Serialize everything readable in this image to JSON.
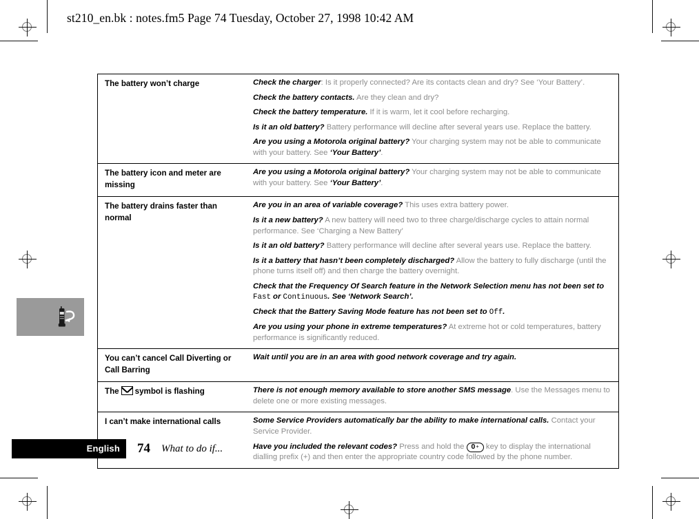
{
  "page_header": "st210_en.bk : notes.fm5  Page 74  Tuesday, October 27, 1998  10:42 AM",
  "thumb_tab": {
    "icon": "phone-with-question-icon",
    "color": "#9a9a9a"
  },
  "footer": {
    "language": "English",
    "page_number": "74",
    "section_title": "What to do if...",
    "bar_color": "#000000"
  },
  "table": {
    "rows": [
      {
        "symptom": "The battery won’t charge",
        "answers": [
          {
            "q": "Check the charger",
            "rest": ": Is it properly connected? Are its contacts clean and dry? See ‘Your Battery’."
          },
          {
            "q": "Check the battery contacts.",
            "rest": " Are they clean and dry?"
          },
          {
            "q": "Check the battery temperature.",
            "rest": " If it is warm, let it cool before recharging."
          },
          {
            "q": "Is it an old battery?",
            "rest": " Battery performance will decline after several years use. Replace the battery."
          },
          {
            "q": "Are you using a Motorola original battery?",
            "rest": " Your charging system may not be able to communicate with your battery. See ",
            "ref": "‘Your Battery’",
            "tail": "."
          }
        ]
      },
      {
        "symptom": "The battery icon and meter are missing",
        "answers": [
          {
            "q": "Are you using a Motorola original battery?",
            "rest": " Your charging system may not be able to communicate with your battery. See ",
            "ref": "‘Your Battery’",
            "tail": "."
          }
        ]
      },
      {
        "symptom": "The battery drains faster than normal",
        "answers": [
          {
            "q": "Are you in an area of variable coverage?",
            "rest": " This uses extra battery power."
          },
          {
            "q": "Is it a new battery?",
            "rest": " A new battery will need two to three charge/discharge cycles to attain normal performance. See ‘Charging a New Battery’"
          },
          {
            "q": "Is it an old battery?",
            "rest": " Battery performance will decline after several years use. Replace the battery."
          },
          {
            "q": "Is it a battery that hasn’t been completely discharged?",
            "rest": " Allow the battery to fully discharge (until the phone turns itself off) and then charge the battery overnight."
          },
          {
            "all_italic": true,
            "segments": [
              {
                "text": "Check that the Frequency Of Search feature in the Network Selection menu has not been set to ",
                "style": "italic"
              },
              {
                "text": "Fast",
                "style": "mono"
              },
              {
                "text": " or ",
                "style": "italic"
              },
              {
                "text": "Continuous",
                "style": "mono"
              },
              {
                "text": ". See ‘Network Search’.",
                "style": "italic"
              }
            ]
          },
          {
            "all_italic": true,
            "segments": [
              {
                "text": "Check that the Battery Saving Mode feature has not been set to ",
                "style": "italic"
              },
              {
                "text": "Off",
                "style": "mono"
              },
              {
                "text": ".",
                "style": "italic"
              }
            ]
          },
          {
            "q": "Are you using your phone in extreme temperatures?",
            "rest": " At extreme hot or cold temperatures, battery performance is significantly reduced."
          }
        ]
      },
      {
        "symptom": "You can’t cancel Call Diverting or Call Barring",
        "answers": [
          {
            "all_italic": true,
            "segments": [
              {
                "text": "Wait until you are in an area with good network coverage and try again.",
                "style": "italic"
              }
            ]
          }
        ]
      },
      {
        "symptom_prefix": "The",
        "symptom_icon": "envelope-icon",
        "symptom_suffix": "symbol is flashing",
        "answers": [
          {
            "q": "There is not enough memory available to store another SMS message",
            "rest": ". Use the Messages menu to delete one or more existing messages."
          }
        ]
      },
      {
        "symptom": "I can’t make international calls",
        "answers": [
          {
            "q": "Some Service Providers automatically bar the ability to make international calls.",
            "rest": " Contact your Service Provider."
          },
          {
            "q": "Have you included the relevant codes?",
            "rest_before_key": " Press and hold the ",
            "key_label": "0",
            "key_plus": "+",
            "rest_after_key": " key to display the international dialling prefix (+) and then enter the appropriate country code followed by the phone number."
          }
        ]
      }
    ]
  }
}
